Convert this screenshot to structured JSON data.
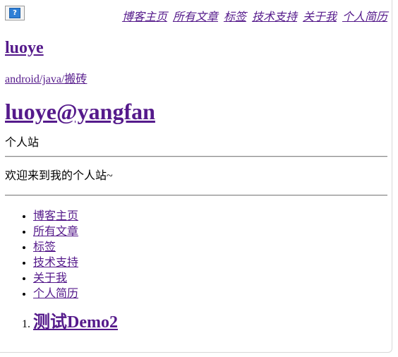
{
  "top_nav": {
    "image_alt_glyph": "?",
    "links": [
      "博客主页",
      "所有文章",
      "标签",
      "技术支持",
      "关于我",
      "个人简历"
    ]
  },
  "site": {
    "title": "luoye",
    "description": "android/java/搬砖",
    "owner": "luoye@yangfan",
    "section_label": "个人站",
    "welcome": "欢迎来到我的个人站~"
  },
  "nav_list": [
    "博客主页",
    "所有文章",
    "标签",
    "技术支持",
    "关于我",
    "个人简历"
  ],
  "posts": [
    {
      "title": "测试Demo2"
    }
  ],
  "colors": {
    "link": "#551a8b",
    "text": "#000000",
    "background": "#ffffff"
  }
}
